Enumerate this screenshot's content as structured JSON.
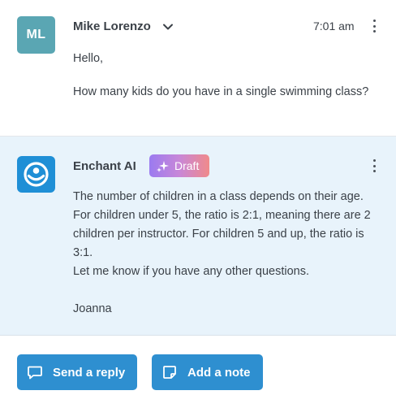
{
  "message1": {
    "avatar_initials": "ML",
    "avatar_color": "#5aa6b3",
    "sender": "Mike Lorenzo",
    "expand_icon": "chevron-down-icon",
    "time": "7:01 am",
    "more_icon": "kebab-menu-icon",
    "greeting": "Hello,",
    "question": "How many kids do you have in a single swimming class?"
  },
  "message2": {
    "avatar_icon": "enchant-ai-logo",
    "avatar_color": "#1f8fd6",
    "sender": "Enchant AI",
    "badge_icon": "sparkle-icon",
    "badge_label": "Draft",
    "more_icon": "kebab-menu-icon",
    "paragraph": "The number of children in a class depends on their age. For children under 5, the ratio is 2:1, meaning there are 2 children per instructor. For children 5 and up, the ratio is 3:1.",
    "closing": "Let me know if you have any other questions.",
    "signature": "Joanna",
    "background_color": "#e8f3fb"
  },
  "actions": {
    "reply_icon": "speech-bubble-icon",
    "reply_label": "Send a reply",
    "note_icon": "note-icon",
    "note_label": "Add a note",
    "button_color": "#2e8fd0"
  }
}
